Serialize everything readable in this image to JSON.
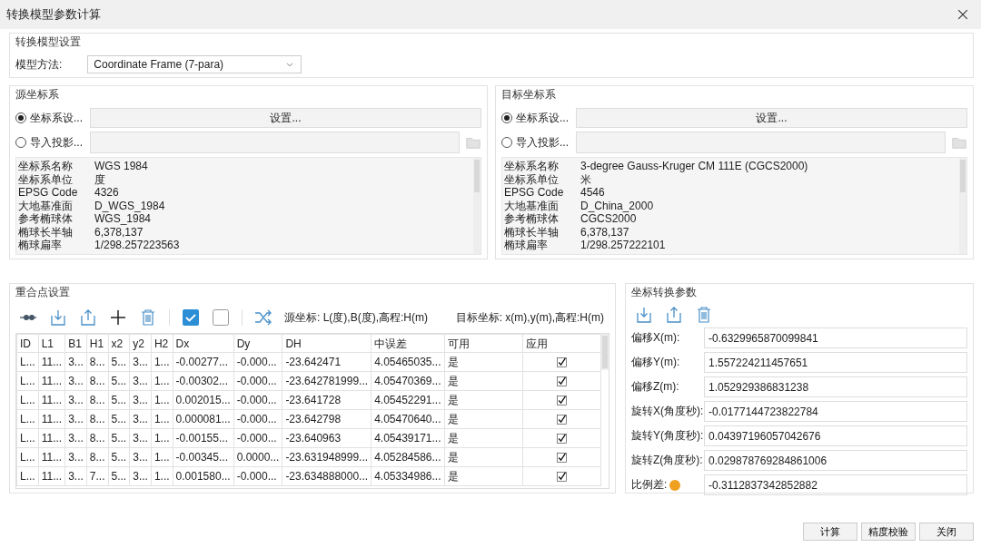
{
  "window": {
    "title": "转换模型参数计算"
  },
  "model_settings": {
    "title": "转换模型设置",
    "label": "模型方法:",
    "value": "Coordinate Frame (7-para)"
  },
  "systems": [
    {
      "title": "源坐标系",
      "options": [
        {
          "label": "坐标系设...",
          "selected": true
        },
        {
          "label": "导入投影...",
          "selected": false
        }
      ],
      "button": "设置...",
      "info": [
        {
          "key": "坐标系名称",
          "value": "WGS 1984"
        },
        {
          "key": "坐标系单位",
          "value": "度"
        },
        {
          "key": "EPSG Code",
          "value": "4326"
        },
        {
          "key": "大地基准面",
          "value": "D_WGS_1984"
        },
        {
          "key": "参考椭球体",
          "value": "WGS_1984"
        },
        {
          "key": "椭球长半轴",
          "value": "6,378,137"
        },
        {
          "key": "椭球扁率",
          "value": "1/298.257223563"
        }
      ]
    },
    {
      "title": "目标坐标系",
      "options": [
        {
          "label": "坐标系设...",
          "selected": true
        },
        {
          "label": "导入投影...",
          "selected": false
        }
      ],
      "button": "设置...",
      "info": [
        {
          "key": "坐标系名称",
          "value": "3-degree Gauss-Kruger CM 111E (CGCS2000)"
        },
        {
          "key": "坐标系单位",
          "value": "米"
        },
        {
          "key": "EPSG Code",
          "value": "4546"
        },
        {
          "key": "大地基准面",
          "value": "D_China_2000"
        },
        {
          "key": "参考椭球体",
          "value": "CGCS2000"
        },
        {
          "key": "椭球长半轴",
          "value": "6,378,137"
        },
        {
          "key": "椭球扁率",
          "value": "1/298.257222101"
        }
      ]
    }
  ],
  "overlap": {
    "title": "重合点设置",
    "source_coords": "源坐标:  L(度),B(度),高程:H(m)",
    "target_coords": "目标坐标:  x(m),y(m),高程:H(m)",
    "columns": [
      "ID",
      "L1",
      "B1",
      "H1",
      "x2",
      "y2",
      "H2",
      "Dx",
      "Dy",
      "DH",
      "中误差",
      "可用",
      "应用"
    ],
    "rows": [
      {
        "cells": [
          "L...",
          "11...",
          "3...",
          "8...",
          "5...",
          "3...",
          "1...",
          "-0.00277...",
          "-0.000...",
          "-23.642471",
          "4.05465035...",
          "是"
        ],
        "checked": true
      },
      {
        "cells": [
          "L...",
          "11...",
          "3...",
          "8...",
          "5...",
          "3...",
          "1...",
          "-0.00302...",
          "-0.000...",
          "-23.642781999...",
          "4.05470369...",
          "是"
        ],
        "checked": true
      },
      {
        "cells": [
          "L...",
          "11...",
          "3...",
          "8...",
          "5...",
          "3...",
          "1...",
          "0.002015...",
          "-0.000...",
          "-23.641728",
          "4.05452291...",
          "是"
        ],
        "checked": true
      },
      {
        "cells": [
          "L...",
          "11...",
          "3...",
          "8...",
          "5...",
          "3...",
          "1...",
          "0.000081...",
          "-0.000...",
          "-23.642798",
          "4.05470640...",
          "是"
        ],
        "checked": true
      },
      {
        "cells": [
          "L...",
          "11...",
          "3...",
          "8...",
          "5...",
          "3...",
          "1...",
          "-0.00155...",
          "-0.000...",
          "-23.640963",
          "4.05439171...",
          "是"
        ],
        "checked": true
      },
      {
        "cells": [
          "L...",
          "11...",
          "3...",
          "8...",
          "5...",
          "3...",
          "1...",
          "-0.00345...",
          "0.0000...",
          "-23.631948999...",
          "4.05284586...",
          "是"
        ],
        "checked": true
      },
      {
        "cells": [
          "L...",
          "11...",
          "3...",
          "7...",
          "5...",
          "3...",
          "1...",
          "0.001580...",
          "-0.000...",
          "-23.634888000...",
          "4.05334986...",
          "是"
        ],
        "checked": true
      }
    ]
  },
  "params": {
    "title": "坐标转换参数",
    "fields": [
      {
        "label": "偏移X(m):",
        "value": "-0.6329965870099841",
        "kind": "plain"
      },
      {
        "label": "偏移Y(m):",
        "value": "1.557224211457651",
        "kind": "plain"
      },
      {
        "label": "偏移Z(m):",
        "value": "1.052929386831238",
        "kind": "plain"
      },
      {
        "label": "旋转X(角度秒):",
        "value": "-0.0177144723822784",
        "kind": "plain"
      },
      {
        "label": "旋转Y(角度秒):",
        "value": "0.04397196057042676",
        "kind": "plain"
      },
      {
        "label": "旋转Z(角度秒):",
        "value": "0.029878769284861006",
        "kind": "plain"
      },
      {
        "label": "比例差:",
        "value": "-0.3112837342852882",
        "kind": "help"
      }
    ]
  },
  "buttons": [
    "计算",
    "精度校验",
    "关闭"
  ]
}
